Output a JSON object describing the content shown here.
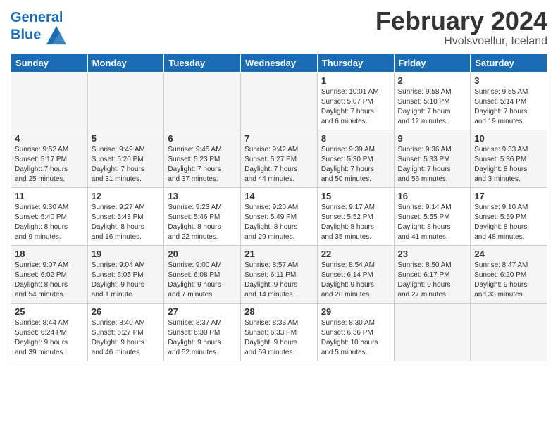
{
  "header": {
    "logo_line1": "General",
    "logo_line2": "Blue",
    "month": "February 2024",
    "location": "Hvolsvoellur, Iceland"
  },
  "days_of_week": [
    "Sunday",
    "Monday",
    "Tuesday",
    "Wednesday",
    "Thursday",
    "Friday",
    "Saturday"
  ],
  "weeks": [
    {
      "shade": false,
      "days": [
        {
          "num": "",
          "info": ""
        },
        {
          "num": "",
          "info": ""
        },
        {
          "num": "",
          "info": ""
        },
        {
          "num": "",
          "info": ""
        },
        {
          "num": "1",
          "info": "Sunrise: 10:01 AM\nSunset: 5:07 PM\nDaylight: 7 hours\nand 6 minutes."
        },
        {
          "num": "2",
          "info": "Sunrise: 9:58 AM\nSunset: 5:10 PM\nDaylight: 7 hours\nand 12 minutes."
        },
        {
          "num": "3",
          "info": "Sunrise: 9:55 AM\nSunset: 5:14 PM\nDaylight: 7 hours\nand 19 minutes."
        }
      ]
    },
    {
      "shade": true,
      "days": [
        {
          "num": "4",
          "info": "Sunrise: 9:52 AM\nSunset: 5:17 PM\nDaylight: 7 hours\nand 25 minutes."
        },
        {
          "num": "5",
          "info": "Sunrise: 9:49 AM\nSunset: 5:20 PM\nDaylight: 7 hours\nand 31 minutes."
        },
        {
          "num": "6",
          "info": "Sunrise: 9:45 AM\nSunset: 5:23 PM\nDaylight: 7 hours\nand 37 minutes."
        },
        {
          "num": "7",
          "info": "Sunrise: 9:42 AM\nSunset: 5:27 PM\nDaylight: 7 hours\nand 44 minutes."
        },
        {
          "num": "8",
          "info": "Sunrise: 9:39 AM\nSunset: 5:30 PM\nDaylight: 7 hours\nand 50 minutes."
        },
        {
          "num": "9",
          "info": "Sunrise: 9:36 AM\nSunset: 5:33 PM\nDaylight: 7 hours\nand 56 minutes."
        },
        {
          "num": "10",
          "info": "Sunrise: 9:33 AM\nSunset: 5:36 PM\nDaylight: 8 hours\nand 3 minutes."
        }
      ]
    },
    {
      "shade": false,
      "days": [
        {
          "num": "11",
          "info": "Sunrise: 9:30 AM\nSunset: 5:40 PM\nDaylight: 8 hours\nand 9 minutes."
        },
        {
          "num": "12",
          "info": "Sunrise: 9:27 AM\nSunset: 5:43 PM\nDaylight: 8 hours\nand 16 minutes."
        },
        {
          "num": "13",
          "info": "Sunrise: 9:23 AM\nSunset: 5:46 PM\nDaylight: 8 hours\nand 22 minutes."
        },
        {
          "num": "14",
          "info": "Sunrise: 9:20 AM\nSunset: 5:49 PM\nDaylight: 8 hours\nand 29 minutes."
        },
        {
          "num": "15",
          "info": "Sunrise: 9:17 AM\nSunset: 5:52 PM\nDaylight: 8 hours\nand 35 minutes."
        },
        {
          "num": "16",
          "info": "Sunrise: 9:14 AM\nSunset: 5:55 PM\nDaylight: 8 hours\nand 41 minutes."
        },
        {
          "num": "17",
          "info": "Sunrise: 9:10 AM\nSunset: 5:59 PM\nDaylight: 8 hours\nand 48 minutes."
        }
      ]
    },
    {
      "shade": true,
      "days": [
        {
          "num": "18",
          "info": "Sunrise: 9:07 AM\nSunset: 6:02 PM\nDaylight: 8 hours\nand 54 minutes."
        },
        {
          "num": "19",
          "info": "Sunrise: 9:04 AM\nSunset: 6:05 PM\nDaylight: 9 hours\nand 1 minute."
        },
        {
          "num": "20",
          "info": "Sunrise: 9:00 AM\nSunset: 6:08 PM\nDaylight: 9 hours\nand 7 minutes."
        },
        {
          "num": "21",
          "info": "Sunrise: 8:57 AM\nSunset: 6:11 PM\nDaylight: 9 hours\nand 14 minutes."
        },
        {
          "num": "22",
          "info": "Sunrise: 8:54 AM\nSunset: 6:14 PM\nDaylight: 9 hours\nand 20 minutes."
        },
        {
          "num": "23",
          "info": "Sunrise: 8:50 AM\nSunset: 6:17 PM\nDaylight: 9 hours\nand 27 minutes."
        },
        {
          "num": "24",
          "info": "Sunrise: 8:47 AM\nSunset: 6:20 PM\nDaylight: 9 hours\nand 33 minutes."
        }
      ]
    },
    {
      "shade": false,
      "days": [
        {
          "num": "25",
          "info": "Sunrise: 8:44 AM\nSunset: 6:24 PM\nDaylight: 9 hours\nand 39 minutes."
        },
        {
          "num": "26",
          "info": "Sunrise: 8:40 AM\nSunset: 6:27 PM\nDaylight: 9 hours\nand 46 minutes."
        },
        {
          "num": "27",
          "info": "Sunrise: 8:37 AM\nSunset: 6:30 PM\nDaylight: 9 hours\nand 52 minutes."
        },
        {
          "num": "28",
          "info": "Sunrise: 8:33 AM\nSunset: 6:33 PM\nDaylight: 9 hours\nand 59 minutes."
        },
        {
          "num": "29",
          "info": "Sunrise: 8:30 AM\nSunset: 6:36 PM\nDaylight: 10 hours\nand 5 minutes."
        },
        {
          "num": "",
          "info": ""
        },
        {
          "num": "",
          "info": ""
        }
      ]
    }
  ]
}
